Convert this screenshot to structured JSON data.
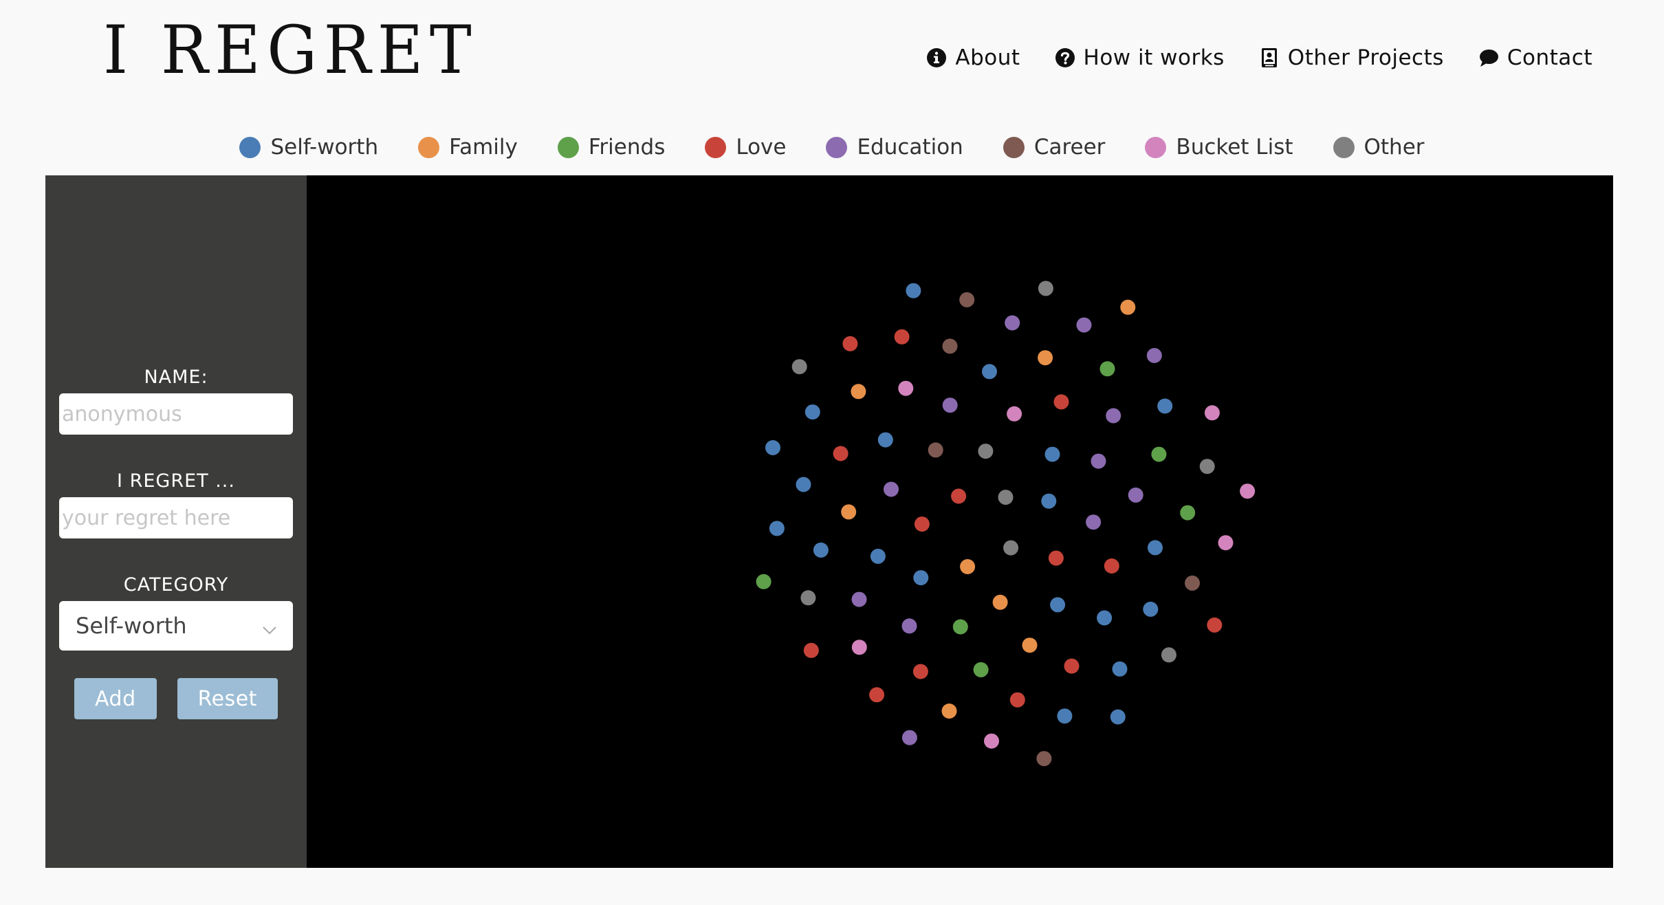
{
  "logo": {
    "text": "I REGRET"
  },
  "nav": [
    {
      "label": "About",
      "icon": "info-icon"
    },
    {
      "label": "How it works",
      "icon": "question-icon"
    },
    {
      "label": "Other Projects",
      "icon": "id-card-icon"
    },
    {
      "label": "Contact",
      "icon": "chat-bubble-icon"
    }
  ],
  "legend": [
    {
      "label": "Self-worth",
      "color": "#4a7db5"
    },
    {
      "label": "Family",
      "color": "#e8914a"
    },
    {
      "label": "Friends",
      "color": "#5fa04b"
    },
    {
      "label": "Love",
      "color": "#c8443a"
    },
    {
      "label": "Education",
      "color": "#8c6bb1"
    },
    {
      "label": "Career",
      "color": "#7e5a52"
    },
    {
      "label": "Bucket List",
      "color": "#d384bd"
    },
    {
      "label": "Other",
      "color": "#808080"
    }
  ],
  "form": {
    "name_label": "NAME:",
    "name_placeholder": "anonymous",
    "regret_label": "I REGRET ...",
    "regret_placeholder": "your regret here",
    "category_label": "CATEGORY",
    "category_selected": "Self-worth",
    "add_label": "Add",
    "reset_label": "Reset"
  },
  "bubbles": {
    "count": 80,
    "category_sequence": [
      "Other",
      "Other",
      "Love",
      "Self-worth",
      "Family",
      "Other",
      "Love",
      "Love",
      "Self-worth",
      "Family",
      "Career",
      "Education",
      "Self-worth",
      "Bucket List",
      "Self-worth",
      "Education",
      "Education",
      "Friends",
      "Education",
      "Love",
      "Self-worth",
      "Love",
      "Family",
      "Self-worth",
      "Education",
      "Education",
      "Self-worth",
      "Self-worth",
      "Family",
      "Education",
      "Friends",
      "Bucket List",
      "Self-worth",
      "Education",
      "Family",
      "Love",
      "Love",
      "Friends",
      "Love",
      "Career",
      "Self-worth",
      "Self-worth",
      "Friends",
      "Love",
      "Family",
      "Friends",
      "Bucket List",
      "Education",
      "Self-worth",
      "Self-worth",
      "Self-worth",
      "Family",
      "Love",
      "Career",
      "Other",
      "Education",
      "Self-worth",
      "Self-worth",
      "Other",
      "Love",
      "Career",
      "Other",
      "Self-worth",
      "Education",
      "Bucket List",
      "Love",
      "Bucket List",
      "Love",
      "Other",
      "Self-worth",
      "Self-worth",
      "Bucket List",
      "Education",
      "Self-worth",
      "Love",
      "Friends",
      "Family",
      "Career",
      "Other",
      "Bucket List"
    ]
  }
}
